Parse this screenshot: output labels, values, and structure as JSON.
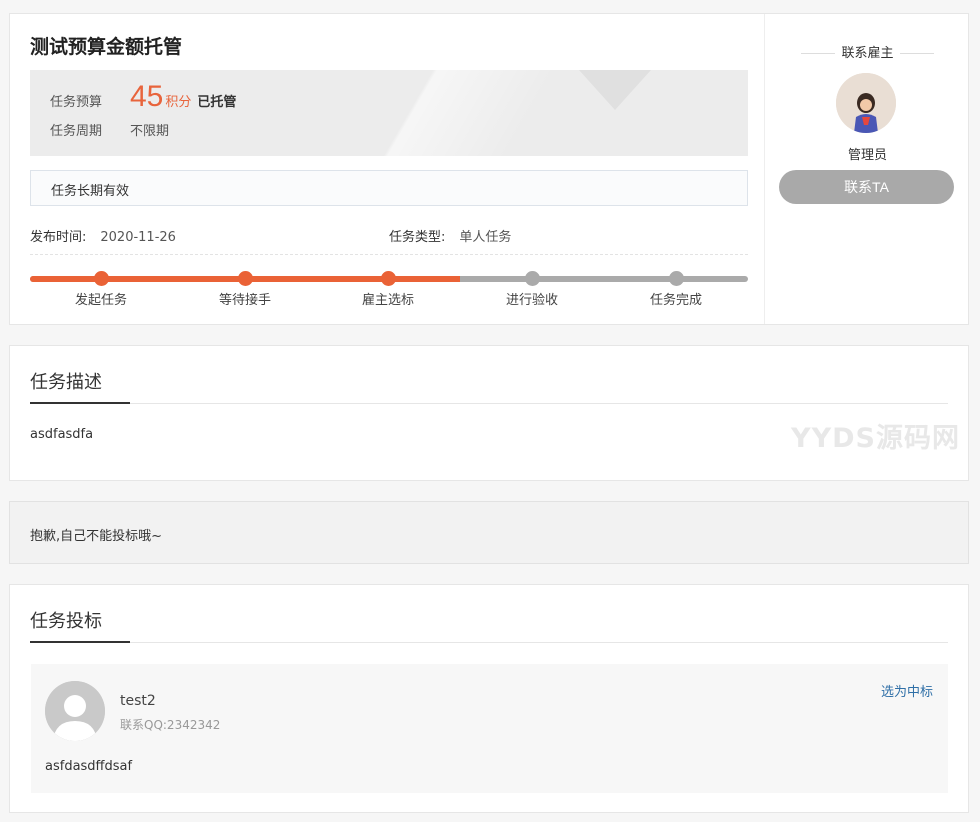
{
  "task": {
    "title": "测试预算金额托管",
    "budget_label": "任务预算",
    "budget_value": "45",
    "budget_unit": "积分",
    "budget_status": "已托管",
    "period_label": "任务周期",
    "period_value": "不限期",
    "validity": "任务长期有效",
    "publish_label": "发布时间:",
    "publish_value": "2020-11-26",
    "type_label": "任务类型:",
    "type_value": "单人任务"
  },
  "progress": {
    "completed_steps": 3,
    "total_steps": 5,
    "steps": [
      "发起任务",
      "等待接手",
      "雇主选标",
      "进行验收",
      "任务完成"
    ]
  },
  "employer": {
    "section_title": "联系雇主",
    "name": "管理员",
    "contact_button": "联系TA"
  },
  "description": {
    "title": "任务描述",
    "text": "asdfasdfa",
    "watermark": "YYDS源码网"
  },
  "notice": {
    "text": "抱歉,自己不能投标哦~"
  },
  "bids": {
    "title": "任务投标",
    "items": [
      {
        "username": "test2",
        "qq": "联系QQ:2342342",
        "action": "选为中标",
        "content": "asfdasdffdsaf"
      }
    ]
  },
  "colors": {
    "accent": "#ea6236",
    "inactive": "#aaaaaa",
    "link": "#2f6fa7"
  }
}
